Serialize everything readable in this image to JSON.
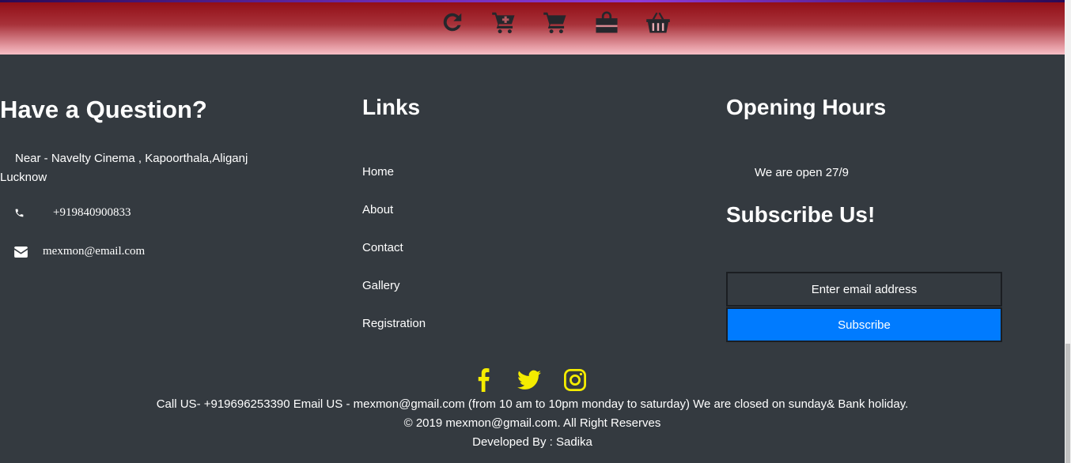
{
  "header": {
    "icons": [
      "refresh-icon",
      "cart-add-icon",
      "cart-icon",
      "shopping-bag-icon",
      "basket-icon"
    ]
  },
  "question": {
    "title": "Have a Question?",
    "address_line1": "Near - Navelty Cinema , Kapoorthala,Aliganj",
    "address_line2": "Lucknow",
    "phone": "+919840900833",
    "email": "mexmon@email.com"
  },
  "links": {
    "title": "Links",
    "items": [
      "Home",
      "About",
      "Contact",
      "Gallery",
      "Registration"
    ]
  },
  "hours": {
    "title": "Opening Hours",
    "text": "We are open 27/9"
  },
  "subscribe": {
    "title": "Subscribe Us!",
    "placeholder": "Enter email address",
    "button": "Subscribe"
  },
  "social": [
    "facebook-icon",
    "twitter-icon",
    "instagram-icon"
  ],
  "footer": {
    "line1": "Call US- +919696253390 Email US - mexmon@gmail.com (from 10 am to 10pm monday to saturday) We are closed on sunday& Bank holiday.",
    "line2": "© 2019 mexmon@gmail.com. All Right Reserves",
    "line3": "Developed By : Sadika"
  },
  "colors": {
    "background": "#343a40",
    "accent_button": "#007bff",
    "social_icon": "#f4ec00",
    "header_band": "#8f0a12"
  }
}
